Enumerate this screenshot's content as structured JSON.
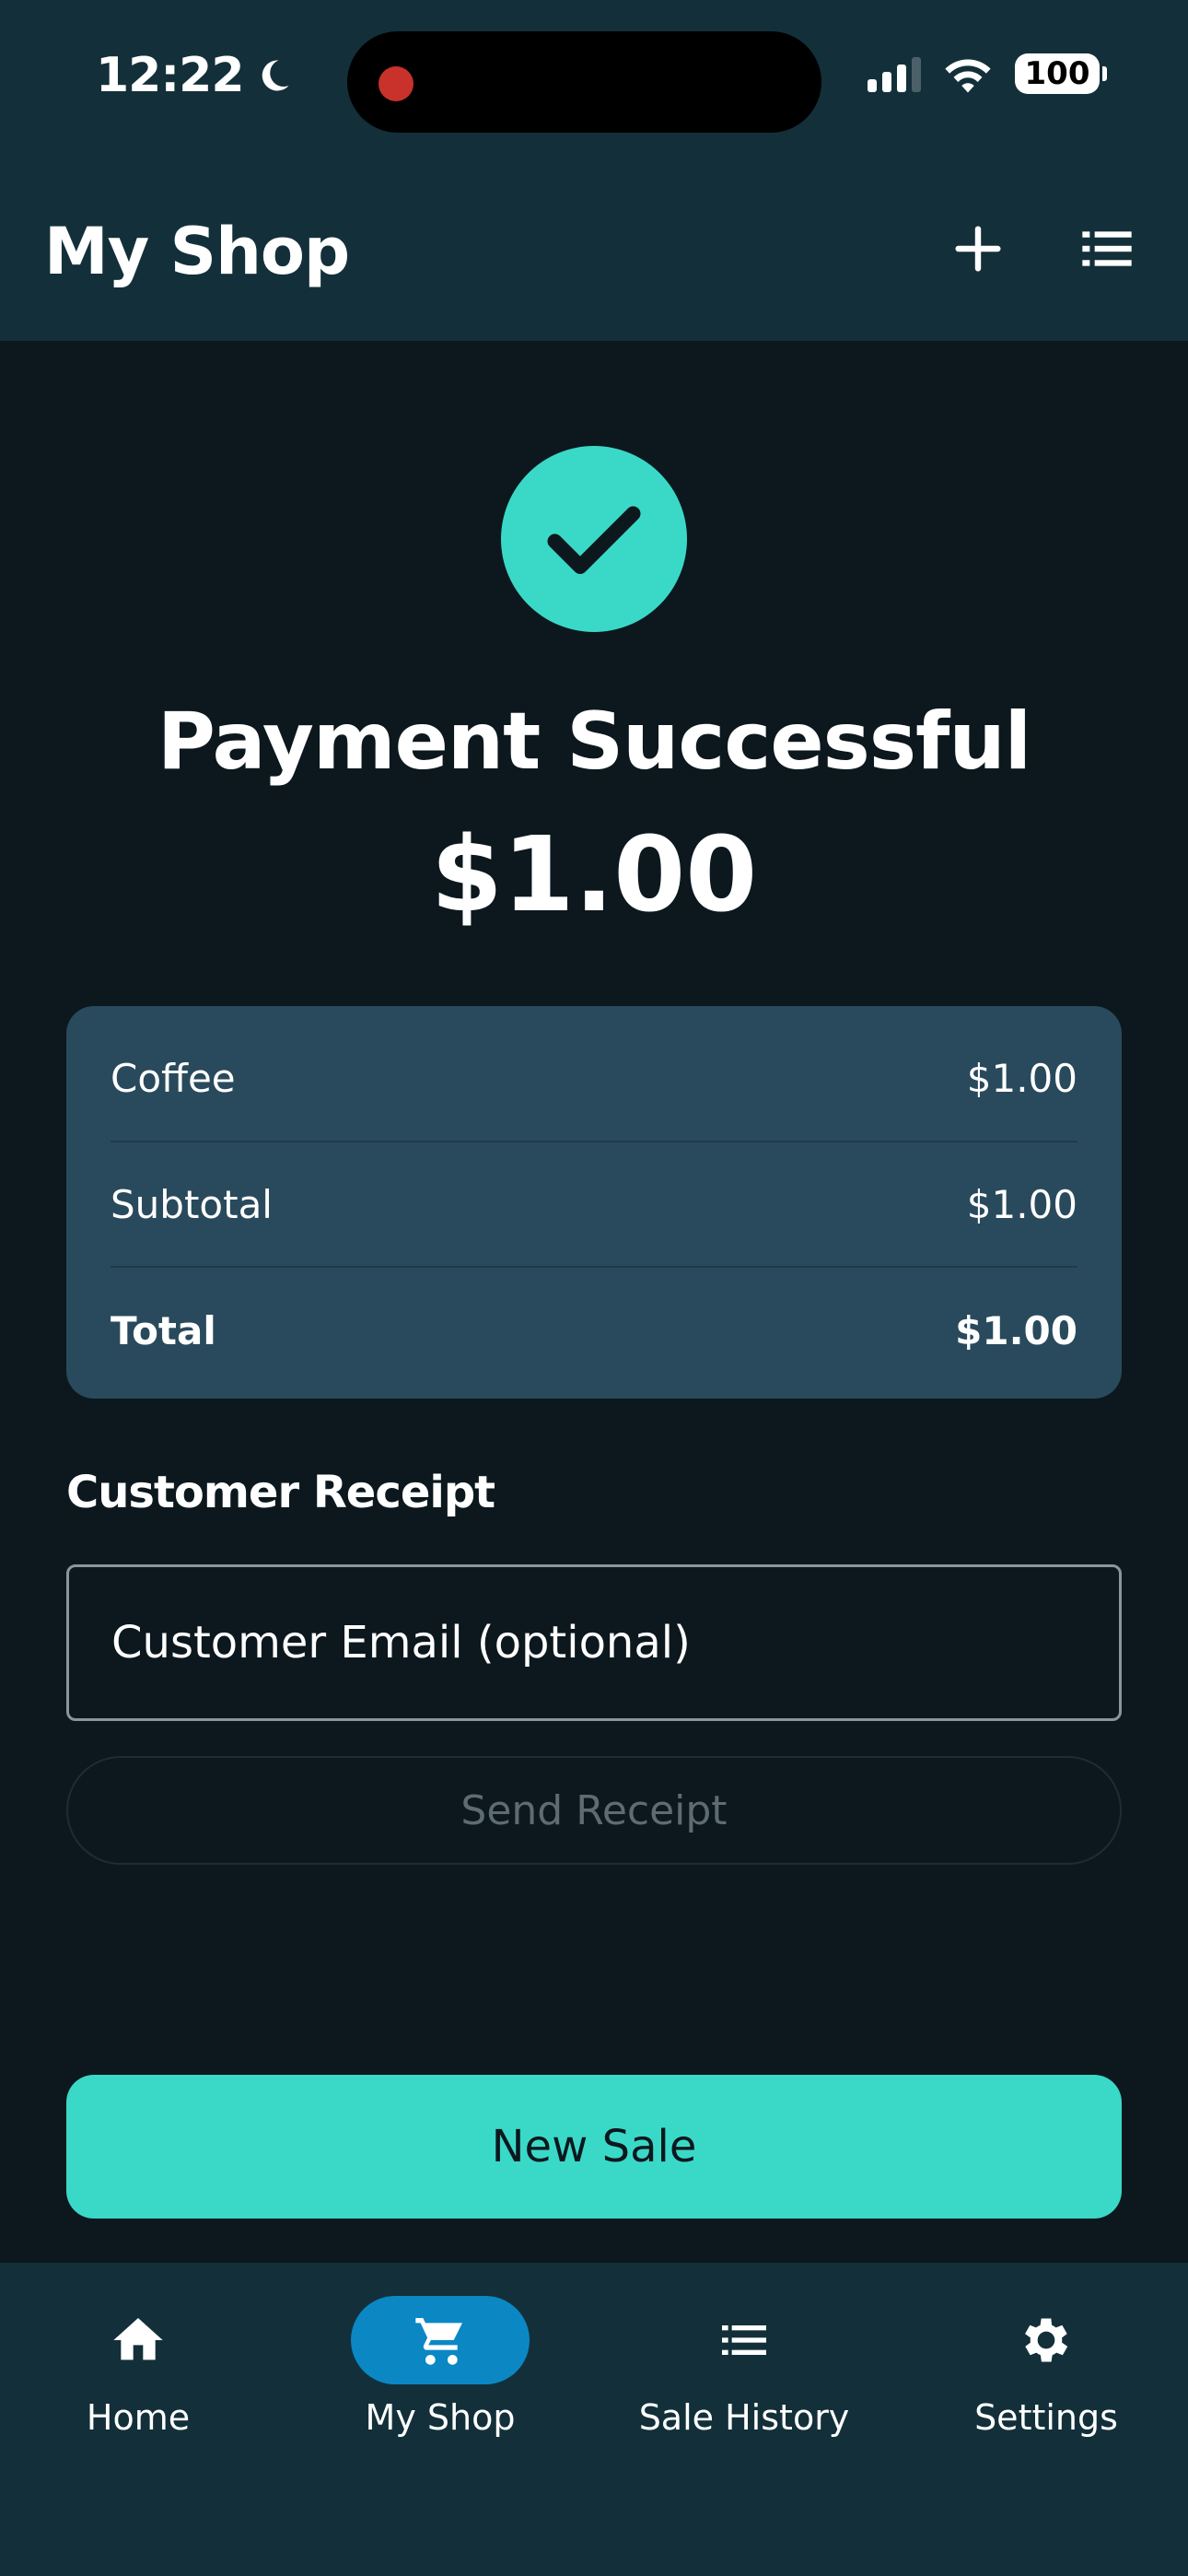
{
  "status_bar": {
    "time": "12:22",
    "battery": "100"
  },
  "header": {
    "title": "My Shop",
    "icons": [
      "plus-icon",
      "list-icon"
    ]
  },
  "payment": {
    "title": "Payment Successful",
    "amount": "$1.00"
  },
  "summary": {
    "rows": [
      {
        "label": "Coffee",
        "value": "$1.00"
      },
      {
        "label": "Subtotal",
        "value": "$1.00"
      },
      {
        "label": "Total",
        "value": "$1.00"
      }
    ]
  },
  "receipt": {
    "section_label": "Customer Receipt",
    "email_placeholder": "Customer Email (optional)",
    "send_label": "Send Receipt"
  },
  "actions": {
    "new_sale_label": "New Sale"
  },
  "bottom_nav": {
    "items": [
      {
        "label": "Home",
        "icon": "home-icon"
      },
      {
        "label": "My Shop",
        "icon": "cart-icon",
        "active": true
      },
      {
        "label": "Sale History",
        "icon": "list-icon"
      },
      {
        "label": "Settings",
        "icon": "gear-icon"
      }
    ]
  },
  "colors": {
    "accent": "#3ad9c7",
    "header_bg": "#13303a",
    "page_bg": "#0c181e",
    "card_bg": "#294a5c",
    "nav_active": "#0b87c4"
  }
}
